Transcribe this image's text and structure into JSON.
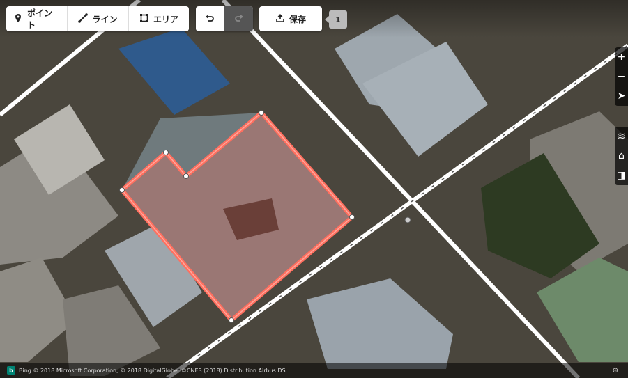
{
  "toolbar": {
    "point_label": "ポイント",
    "line_label": "ライン",
    "area_label": "エリア",
    "save_label": "保存",
    "edit_count": "1"
  },
  "footer": {
    "attribution": "Bing  © 2018 Microsoft Corporation, © 2018 DigitalGlobe, ©CNES (2018) Distribution Airbus DS"
  },
  "icons": {
    "point": "map-pin-icon",
    "line": "line-icon",
    "area": "area-icon",
    "undo": "undo-icon",
    "redo": "redo-icon",
    "save": "upload-icon",
    "zoom_in": "zoom-in-icon",
    "zoom_out": "zoom-out-icon",
    "locate": "locate-icon",
    "layers": "layers-icon",
    "map_data": "map-data-icon",
    "issues": "issues-icon"
  },
  "colors": {
    "selected_area": "#ff6f5f",
    "road": "#ffffff",
    "toolbar_bg": "#ffffff"
  }
}
